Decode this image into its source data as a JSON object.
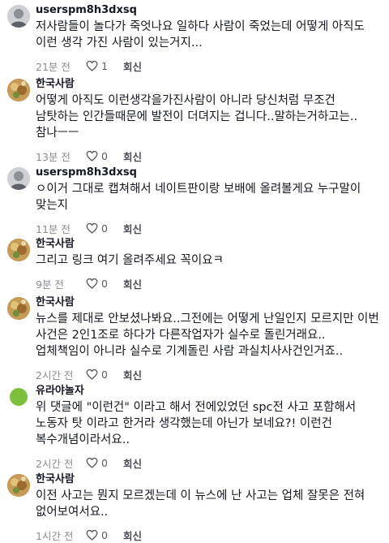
{
  "comments": [
    {
      "username": "userspm8h3dxsq",
      "text": "저사람들이 놀다가 죽엇나요 일하다 사람이 죽었는데 어떻게 아직도 이런 생각 가진 사람이 있는거지...",
      "time": "21분 전",
      "likes": "1",
      "reply_label": "회신",
      "avatar": "gray-profile"
    },
    {
      "username": "한국사람",
      "text": "어떻게 아직도 이런생각을가진사람이 아니라 당신처럼 무조건 남탓하는 인간들때문에 발전이 더뎌지는 겁니다..말하는거하고는..참나ㅡㅡ",
      "time": "13분 전",
      "likes": "0",
      "reply_label": "회신",
      "avatar": "food-photo"
    },
    {
      "username": "userspm8h3dxsq",
      "text": "ㅇ이거 그대로 캡쳐해서 네이트판이랑 보배에 올려볼게요 누구말이 맞는지",
      "time": "11분 전",
      "likes": "0",
      "reply_label": "회신",
      "avatar": "gray-profile"
    },
    {
      "username": "한국사람",
      "text": "그리고 링크 여기 올려주세요 꼭이요ㅋ",
      "time": "9분 전",
      "likes": "0",
      "reply_label": "회신",
      "avatar": "food-photo"
    },
    {
      "username": "한국사람",
      "text": "뉴스를 제대로 안보셨나봐요..그전에는 어떻게 난일인지 모르지만 이번 사건은 2인1조로 하다가 다른작업자가 실수로 돌린거래요..업체책임이 아니라 실수로 기계돌린 사람 과실치사사건인거죠..",
      "time": "2시간 전",
      "likes": "0",
      "reply_label": "회신",
      "avatar": "food-photo"
    },
    {
      "username": "유라야놀자",
      "text": "위 댓글에 \"이런건\" 이라고 해서 전에있었던 spc전 사고 포함해서 노동자 탓 이라고 한거라 생각했는데 아닌가 보네요?! 이런건 복수개념이라서요..",
      "time": "2시간 전",
      "likes": "0",
      "reply_label": "회신",
      "avatar": "green-dot"
    },
    {
      "username": "한국사람",
      "text": "이전 사고는 뭔지 모르겠는데 이 뉴스에 난 사고는 업체 잘못은 전혀 없어보여서요..",
      "time": "1시간 전",
      "likes": "0",
      "reply_label": "회신",
      "avatar": "food-photo"
    }
  ],
  "colors": {
    "text": "#161823",
    "meta": "#8a8b91",
    "green_avatar": "#7dc03c"
  }
}
